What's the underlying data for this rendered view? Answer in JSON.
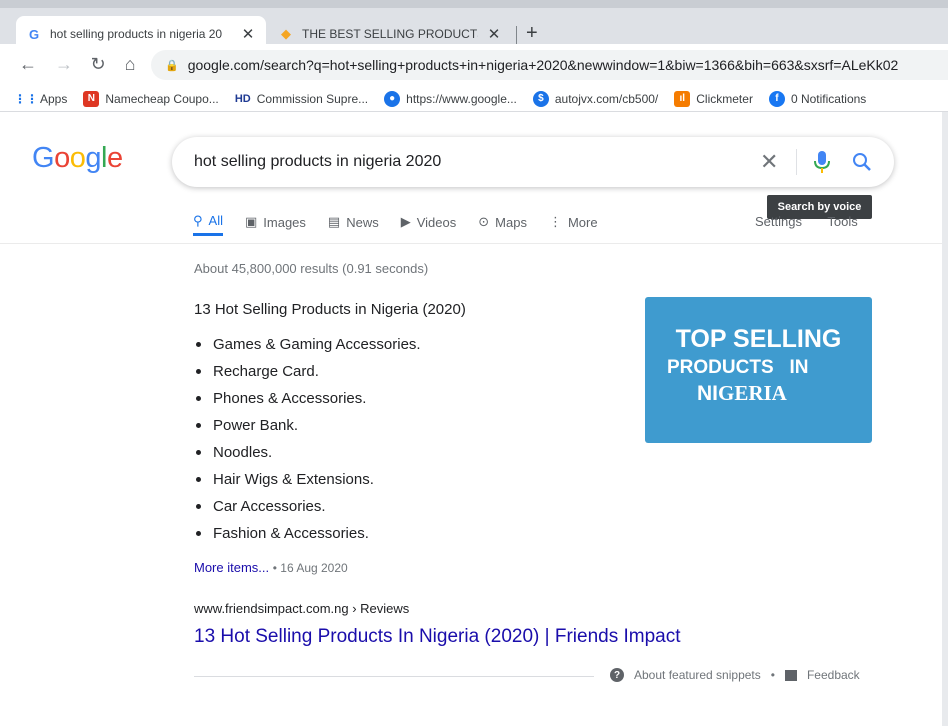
{
  "browser": {
    "tabs": [
      {
        "title": "hot selling products in nigeria 20",
        "icon": "google-g-icon",
        "active": true
      },
      {
        "title": "THE BEST SELLING PRODUCTS IN",
        "icon": "orange-diamond-icon",
        "active": false
      }
    ],
    "new_tab": "+",
    "address": "google.com/search?q=hot+selling+products+in+nigeria+2020&newwindow=1&biw=1366&bih=663&sxsrf=ALeKk02",
    "bookmarks": [
      {
        "label": "Apps",
        "icon": "apps-grid-icon",
        "color": "#1a73e8"
      },
      {
        "label": "Namecheap Coupo...",
        "icon": "namecheap-icon",
        "color": "#de3723"
      },
      {
        "label": "Commission Supre...",
        "icon": "hd-icon",
        "color": "#1f3a93"
      },
      {
        "label": "https://www.google...",
        "icon": "globe-icon",
        "color": "#1a73e8"
      },
      {
        "label": "autojvx.com/cb500/",
        "icon": "autojvx-icon",
        "color": "#1a73e8"
      },
      {
        "label": "Clickmeter",
        "icon": "clickmeter-icon",
        "color": "#f57c00"
      },
      {
        "label": "0 Notifications",
        "icon": "facebook-icon",
        "color": "#1877f2"
      }
    ]
  },
  "google": {
    "logo": [
      "G",
      "o",
      "o",
      "g",
      "l",
      "e"
    ],
    "logo_colors": [
      "#4285f4",
      "#ea4335",
      "#fbbc05",
      "#4285f4",
      "#34a853",
      "#ea4335"
    ],
    "query": "hot selling products in nigeria 2020",
    "tooltip": "Search by voice",
    "tabs": [
      {
        "label": "All",
        "icon": "search-icon",
        "active": true
      },
      {
        "label": "Images",
        "icon": "image-icon"
      },
      {
        "label": "News",
        "icon": "news-icon"
      },
      {
        "label": "Videos",
        "icon": "video-icon"
      },
      {
        "label": "Maps",
        "icon": "map-pin-icon"
      },
      {
        "label": "More",
        "icon": "more-dots-icon"
      }
    ],
    "settings": "Settings",
    "tools": "Tools",
    "stats": "About 45,800,000 results (0.91 seconds)"
  },
  "snippet": {
    "title": "13 Hot Selling Products in Nigeria (2020)",
    "items": [
      "Games & Gaming Accessories.",
      "Recharge Card.",
      "Phones & Accessories.",
      "Power Bank.",
      "Noodles.",
      "Hair Wigs & Extensions.",
      "Car Accessories.",
      "Fashion & Accessories."
    ],
    "more_items": "More items...",
    "date": "16 Aug 2020",
    "image": {
      "line1": "TOP SELLING",
      "line2": "PRODUCTS   IN",
      "line3_bold": "NI",
      "line3_rest": "GERIA",
      "bg_color": "#3f9bcf"
    },
    "url": "www.friendsimpact.com.ng › Reviews",
    "result_title": "13 Hot Selling Products In Nigeria (2020) | Friends Impact",
    "about": "About featured snippets",
    "feedback": "Feedback"
  }
}
